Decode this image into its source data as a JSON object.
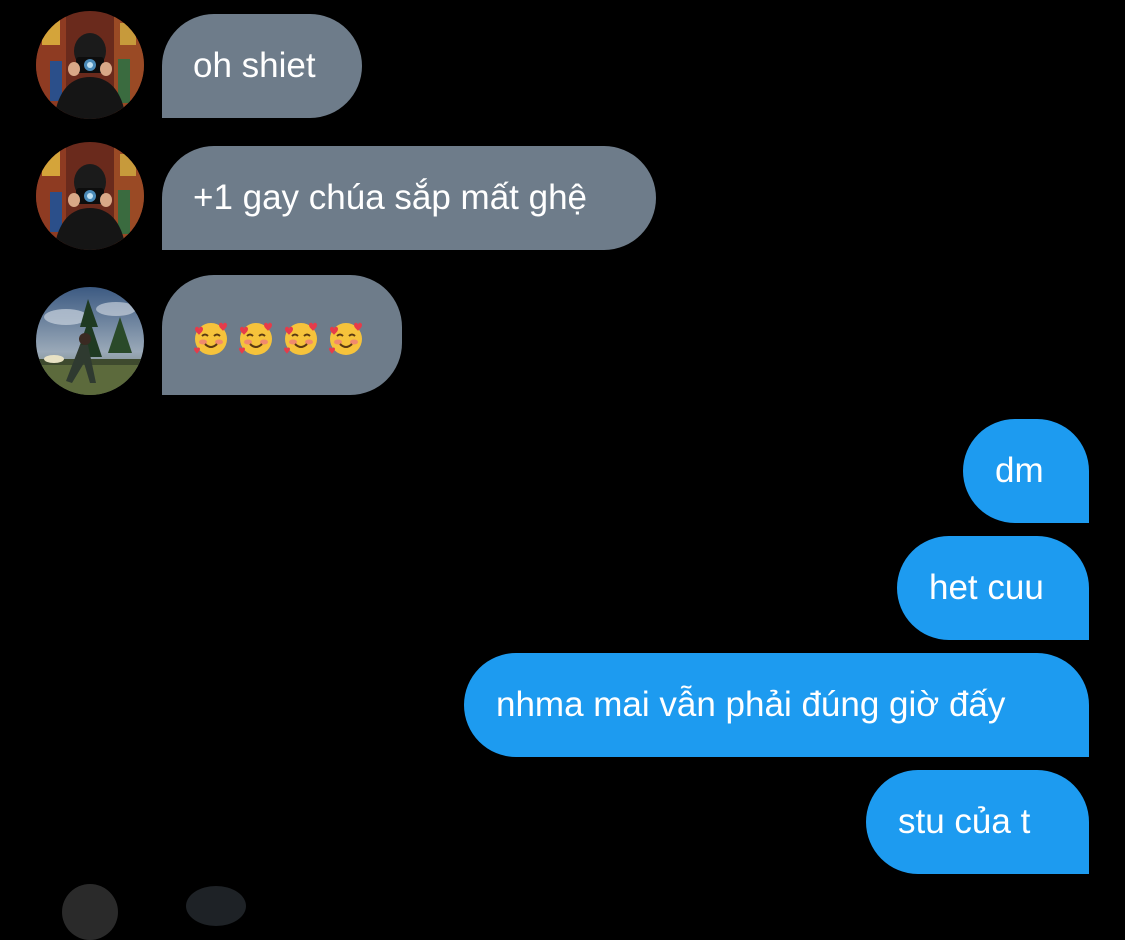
{
  "incoming": [
    {
      "sender": "user-a",
      "text": "oh shiet"
    },
    {
      "sender": "user-a",
      "text": "+1 gay chúa sắp mất ghệ"
    },
    {
      "sender": "user-b",
      "emoji_name": "smiling-face-with-hearts",
      "emoji_count": 4
    }
  ],
  "outgoing": [
    {
      "text": "dm"
    },
    {
      "text": "het cuu"
    },
    {
      "text": "nhma mai vẫn phải đúng giờ đấy"
    },
    {
      "text": "stu của t"
    }
  ],
  "colors": {
    "background": "#000000",
    "incoming_bubble": "#6e7c8a",
    "outgoing_bubble": "#1d9bf0",
    "text": "#ffffff"
  }
}
